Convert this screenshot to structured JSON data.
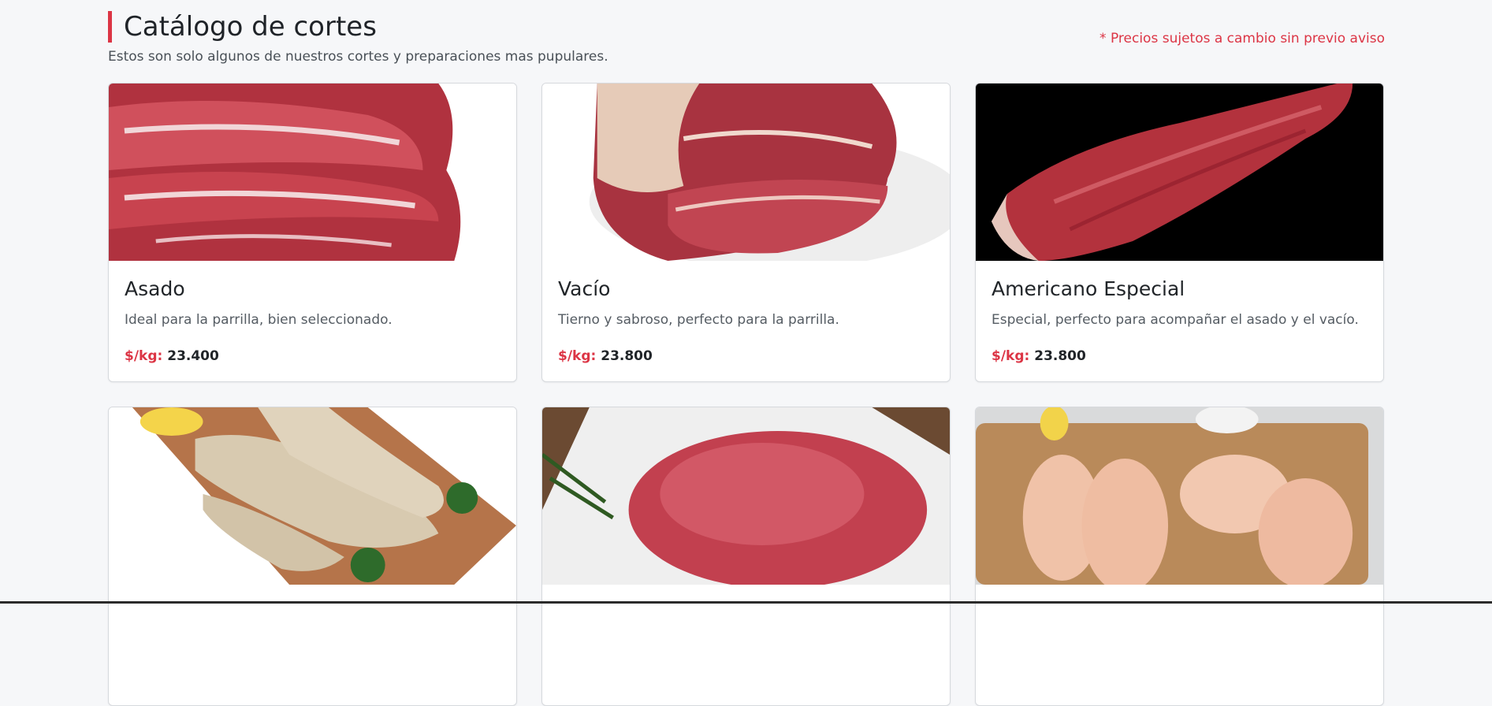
{
  "header": {
    "title": "Catálogo de cortes",
    "subtitle": "Estos son solo algunos de nuestros cortes y preparaciones mas pupulares.",
    "disclaimer": "* Precios sujetos a cambio sin previo aviso"
  },
  "products": [
    {
      "name": "Asado",
      "description": "Ideal para la parrilla, bien seleccionado.",
      "price_label": "$/kg:",
      "price": "23.400"
    },
    {
      "name": "Vacío",
      "description": "Tierno y sabroso, perfecto para la parrilla.",
      "price_label": "$/kg:",
      "price": "23.800"
    },
    {
      "name": "Americano Especial",
      "description": "Especial, perfecto para acompañar el asado y el vacío.",
      "price_label": "$/kg:",
      "price": "23.800"
    }
  ],
  "colors": {
    "accent": "#dc3545",
    "background": "#f6f7f9"
  }
}
